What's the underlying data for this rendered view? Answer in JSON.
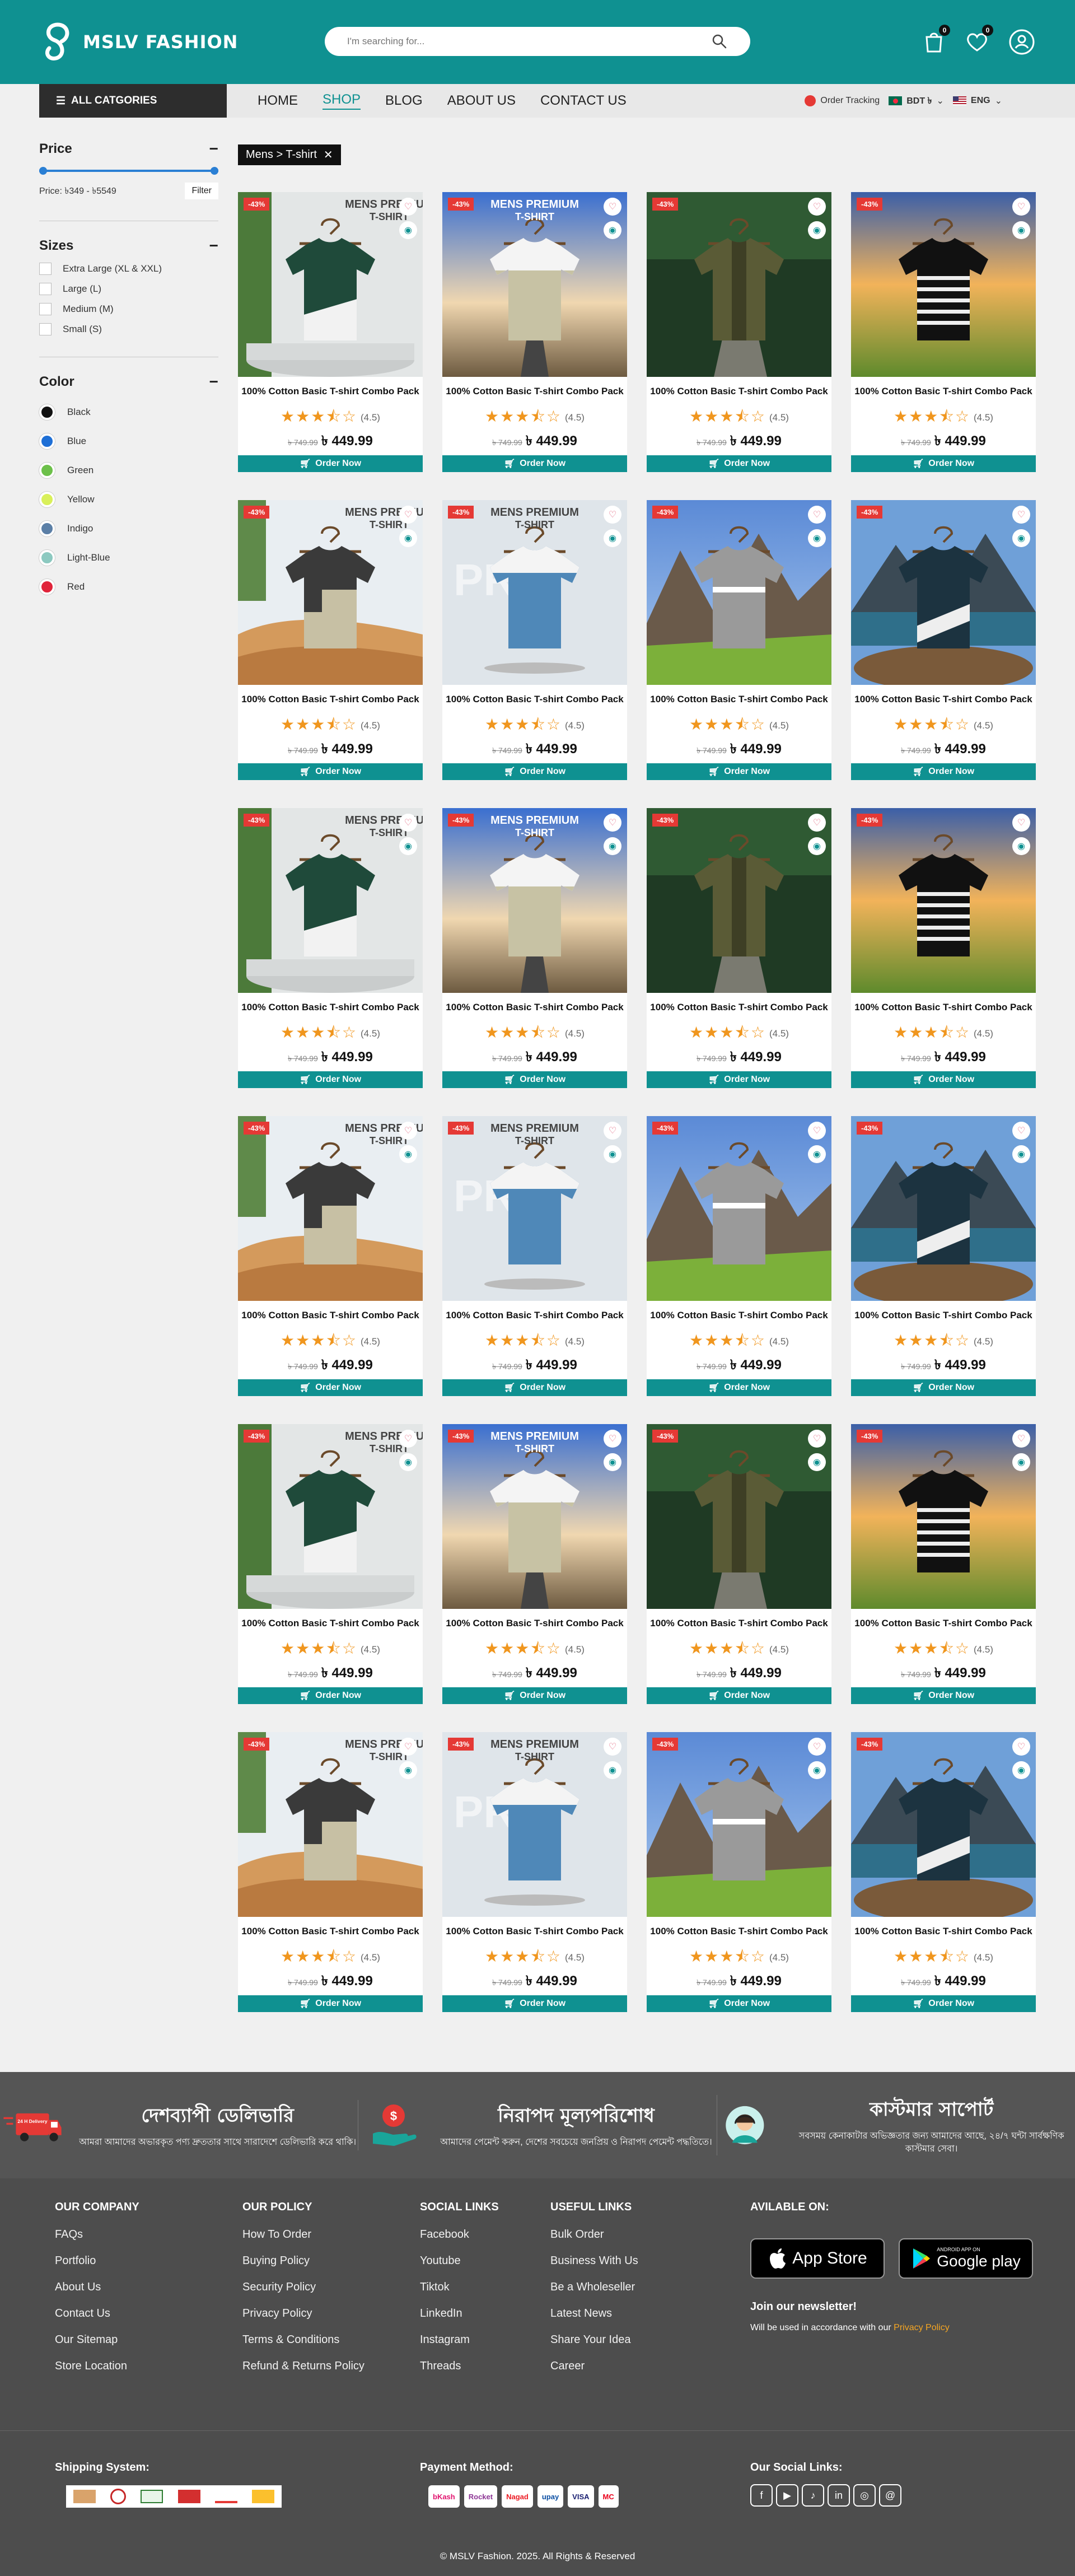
{
  "brand": {
    "name": "MSLV FASHION"
  },
  "search": {
    "placeholder": "I'm searching for..."
  },
  "header": {
    "cart_count": "0",
    "wishlist_count": "0"
  },
  "nav": {
    "all_categories": "ALL CATGORIES",
    "links": [
      "HOME",
      "SHOP",
      "BLOG",
      "ABOUT US",
      "CONTACT US"
    ],
    "active": "SHOP",
    "order_tracking": "Order Tracking",
    "currency": "BDT ৳",
    "language": "ENG"
  },
  "sidebar": {
    "price_title": "Price",
    "price_range": "Price: ৳349 - ৳5549",
    "filter_label": "Filter",
    "sizes_title": "Sizes",
    "sizes": [
      "Extra Large (XL & XXL)",
      "Large (L)",
      "Medium (M)",
      "Small (S)"
    ],
    "color_title": "Color",
    "colors": [
      {
        "name": "Black",
        "hex": "#111111"
      },
      {
        "name": "Blue",
        "hex": "#1e6fd6"
      },
      {
        "name": "Green",
        "hex": "#6cc04a"
      },
      {
        "name": "Yellow",
        "hex": "#d9f05a"
      },
      {
        "name": "Indigo",
        "hex": "#5b7fa6"
      },
      {
        "name": "Light-Blue",
        "hex": "#8cc9c0"
      },
      {
        "name": "Red",
        "hex": "#e0243a"
      }
    ]
  },
  "breadcrumb": {
    "label": "Mens > T-shirt"
  },
  "product": {
    "title": "100% Cotton Basic T-shirt Combo Pack",
    "discount": "-43%",
    "rating": "(4.5)",
    "old_price": "৳ 749.99",
    "new_price": "৳ 449.99",
    "order_label": "Order Now",
    "banner": "MENS PREMIUM",
    "banner_sub": "T-SHIRT"
  },
  "features": [
    {
      "title": "দেশব্যাপী ডেলিভারি",
      "subtitle": "আমরা আমাদের অভারকৃত পণ্য দ্রুততার সাথে সারাদেশে ডেলিভারি করে থাকি।",
      "icon": "delivery-truck-icon",
      "badge": "24 H Delivery"
    },
    {
      "title": "নিরাপদ মূল্যপরিশোধ",
      "subtitle": "আমাদের পেমেন্ট করুন, দেশের সবচেয়ে জনপ্রিয় ও নিরাপদ পেমেন্ট পদ্ধতিতে।",
      "icon": "secure-payment-icon"
    },
    {
      "title": "কাস্টমার সাপোর্ট",
      "subtitle": "সবসময় কেনাকাটার অভিজ্ঞতার জন্য আমাদের আছে, ২৪/৭ ঘন্টা সার্বক্ষণিক কাস্টমার সেবা।",
      "icon": "customer-support-icon"
    }
  ],
  "footer": {
    "company": {
      "title": "OUR COMPANY",
      "links": [
        "FAQs",
        "Portfolio",
        "About Us",
        "Contact Us",
        "Our Sitemap",
        "Store Location"
      ]
    },
    "policy": {
      "title": "OUR POLICY",
      "links": [
        "How To Order",
        "Buying Policy",
        "Security Policy",
        "Privacy Policy",
        "Terms & Conditions",
        "Refund & Returns Policy"
      ]
    },
    "social": {
      "title": "SOCIAL LINKS",
      "links": [
        "Facebook",
        "Youtube",
        "Tiktok",
        "LinkedIn",
        "Instagram",
        "Threads"
      ]
    },
    "useful": {
      "title": "USEFUL LINKS",
      "links": [
        "Bulk Order",
        "Business With Us",
        "Be a Wholeseller",
        "Latest News",
        "Share Your Idea",
        "Career"
      ]
    },
    "available_on": "AVILABLE ON:",
    "app_store": "App Store",
    "google_play_small": "ANDROID APP ON",
    "google_play": "Google play",
    "newsletter_title": "Join our newsletter!",
    "newsletter_text": "Will be used in accordance with our",
    "privacy_link": "Privacy Policy",
    "shipping_title": "Shipping System:",
    "payment_title": "Payment Method:",
    "payment_methods": [
      "bKash",
      "Rocket",
      "Nagad",
      "upay",
      "VISA",
      "MC"
    ],
    "social_title": "Our Social Links:",
    "copyright": "© MSLV Fashion. 2025. All Rights & Reserved"
  },
  "accent": "#0f9191",
  "products": [
    {
      "bg": "podium",
      "shirt": "greenwhite"
    },
    {
      "bg": "road",
      "shirt": "grayolive"
    },
    {
      "bg": "forest",
      "shirt": "olive"
    },
    {
      "bg": "sunset",
      "shirt": "stripes"
    },
    {
      "bg": "desert",
      "shirt": "charbeige"
    },
    {
      "bg": "studio",
      "shirt": "bluewhite"
    },
    {
      "bg": "mountain",
      "shirt": "graystripe"
    },
    {
      "bg": "lake",
      "shirt": "navywhite"
    },
    {
      "bg": "podium",
      "shirt": "greenwhite"
    },
    {
      "bg": "road",
      "shirt": "grayolive"
    },
    {
      "bg": "forest",
      "shirt": "olive"
    },
    {
      "bg": "sunset",
      "shirt": "stripes"
    },
    {
      "bg": "desert",
      "shirt": "charbeige"
    },
    {
      "bg": "studio",
      "shirt": "bluewhite"
    },
    {
      "bg": "mountain",
      "shirt": "graystripe"
    },
    {
      "bg": "lake",
      "shirt": "navywhite"
    },
    {
      "bg": "podium",
      "shirt": "greenwhite"
    },
    {
      "bg": "road",
      "shirt": "grayolive"
    },
    {
      "bg": "forest",
      "shirt": "olive"
    },
    {
      "bg": "sunset",
      "shirt": "stripes"
    },
    {
      "bg": "desert",
      "shirt": "charbeige"
    },
    {
      "bg": "studio",
      "shirt": "bluewhite"
    },
    {
      "bg": "mountain",
      "shirt": "graystripe"
    },
    {
      "bg": "lake",
      "shirt": "navywhite"
    }
  ]
}
